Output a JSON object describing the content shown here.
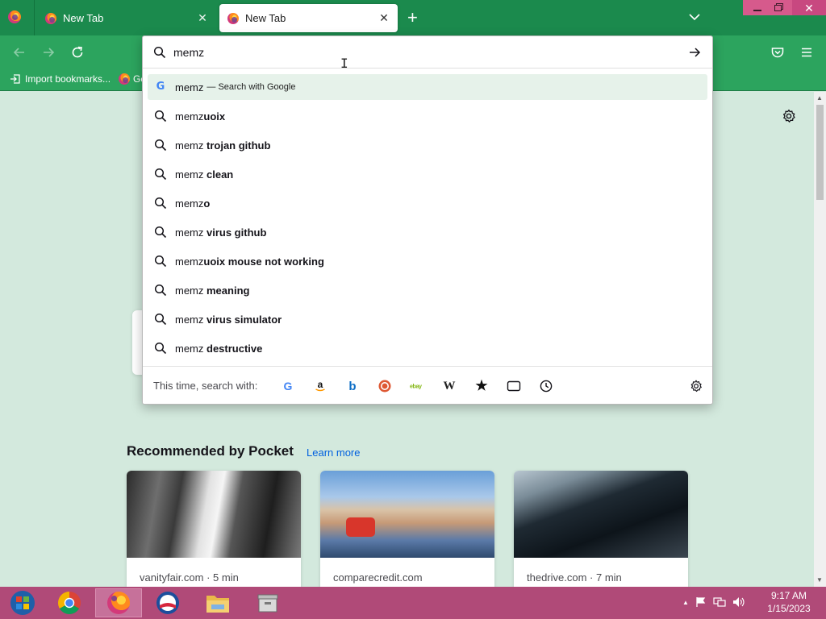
{
  "colors": {
    "tabstrip": "#1b8a4d",
    "toolbar": "#2ca45e",
    "page_background": "#d3e9dd",
    "taskbar": "#b04a78",
    "link": "#0060df"
  },
  "tabs": [
    {
      "title": "New Tab",
      "active": false,
      "icon": "firefox-icon"
    },
    {
      "title": "New Tab",
      "active": true,
      "icon": "firefox-icon"
    }
  ],
  "bookmarks": {
    "import_label": "Import bookmarks...",
    "getting_started_label": "Ge"
  },
  "urlbar": {
    "value": "memz",
    "suggestions": [
      {
        "typed": "memz",
        "bold": "",
        "action": "— Search with Google",
        "icon": "google-icon",
        "selected": true
      },
      {
        "typed": "memz",
        "bold": "uoix",
        "icon": "search-icon"
      },
      {
        "typed": "memz ",
        "bold": "trojan github",
        "icon": "search-icon"
      },
      {
        "typed": "memz ",
        "bold": "clean",
        "icon": "search-icon"
      },
      {
        "typed": "memz",
        "bold": "o",
        "icon": "search-icon"
      },
      {
        "typed": "memz ",
        "bold": "virus github",
        "icon": "search-icon"
      },
      {
        "typed": "memz",
        "bold": "uoix mouse not working",
        "icon": "search-icon"
      },
      {
        "typed": "memz ",
        "bold": "meaning",
        "icon": "search-icon"
      },
      {
        "typed": "memz ",
        "bold": "virus simulator",
        "icon": "search-icon"
      },
      {
        "typed": "memz ",
        "bold": "destructive",
        "icon": "search-icon"
      }
    ],
    "oneoff_label": "This time, search with:",
    "engines": {
      "google": "G",
      "amazon": "a",
      "bing": "b",
      "ebay": "ebay",
      "wikipedia": "W",
      "bookmarks": "★"
    }
  },
  "pocket": {
    "heading": "Recommended by Pocket",
    "learn_more": "Learn more",
    "cards": [
      {
        "source": "vanityfair.com · 5 min"
      },
      {
        "source": "comparecredit.com"
      },
      {
        "source": "thedrive.com · 7 min"
      }
    ]
  },
  "taskbar": {
    "time": "9:17 AM",
    "date": "1/15/2023",
    "tray_arrow": "▲"
  }
}
